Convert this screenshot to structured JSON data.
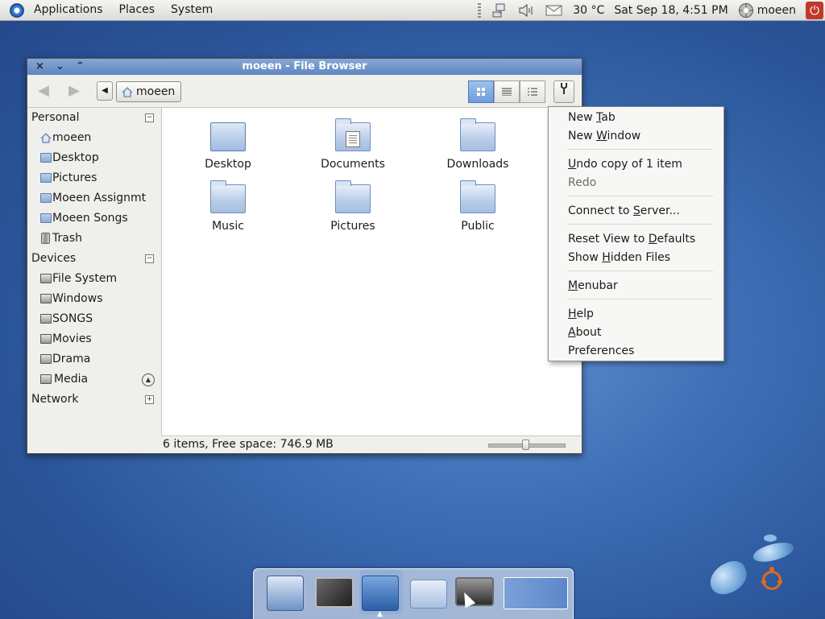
{
  "top_panel": {
    "menus": [
      "Applications",
      "Places",
      "System"
    ],
    "weather": "30 °C",
    "datetime": "Sat Sep 18,  4:51 PM",
    "user": "moeen",
    "icons": [
      "ubuntu-logo-icon",
      "network-icon",
      "volume-icon",
      "mail-icon",
      "user-icon",
      "power-icon"
    ]
  },
  "window": {
    "title": "moeen - File Browser",
    "path_button": "moeen",
    "sidebar": {
      "personal": {
        "label": "Personal",
        "items": [
          "moeen",
          "Desktop",
          "Pictures",
          "Moeen Assignmt",
          "Moeen Songs",
          "Trash"
        ]
      },
      "devices": {
        "label": "Devices",
        "items": [
          "File System",
          "Windows",
          "SONGS",
          "Movies",
          "Drama",
          "Media"
        ]
      },
      "network": {
        "label": "Network"
      }
    },
    "files": [
      "Desktop",
      "Documents",
      "Downloads",
      "Music",
      "Pictures",
      "Public"
    ],
    "status": "6 items, Free space: 746.9 MB",
    "zoom_level": 0.5
  },
  "context_menu": {
    "new_tab": {
      "pre": "New ",
      "ul": "T",
      "post": "ab"
    },
    "new_window": {
      "pre": "New ",
      "ul": "W",
      "post": "indow"
    },
    "undo": {
      "pre": "",
      "ul": "U",
      "post": "ndo copy of 1 item"
    },
    "redo": "Redo",
    "connect": {
      "pre": "Connect to ",
      "ul": "S",
      "post": "erver..."
    },
    "reset": {
      "pre": "Reset View to ",
      "ul": "D",
      "post": "efaults"
    },
    "hidden": {
      "pre": "Show ",
      "ul": "H",
      "post": "idden Files"
    },
    "menubar": {
      "pre": "",
      "ul": "M",
      "post": "enubar"
    },
    "help": {
      "pre": "",
      "ul": "H",
      "post": "elp"
    },
    "about": {
      "pre": "",
      "ul": "A",
      "post": "bout"
    },
    "prefs": {
      "pre": "Preferences",
      "ul": "",
      "post": ""
    }
  },
  "dock": {
    "items": [
      "add-to-desktop-icon",
      "terminal-icon",
      "file-manager-icon",
      "folder-icon",
      "monitor-icon",
      "workspace-switcher-icon"
    ]
  },
  "colors": {
    "title_bar": "#6f93c9",
    "accent": "#7aa6df",
    "ubuntu_orange": "#e06a1c"
  }
}
